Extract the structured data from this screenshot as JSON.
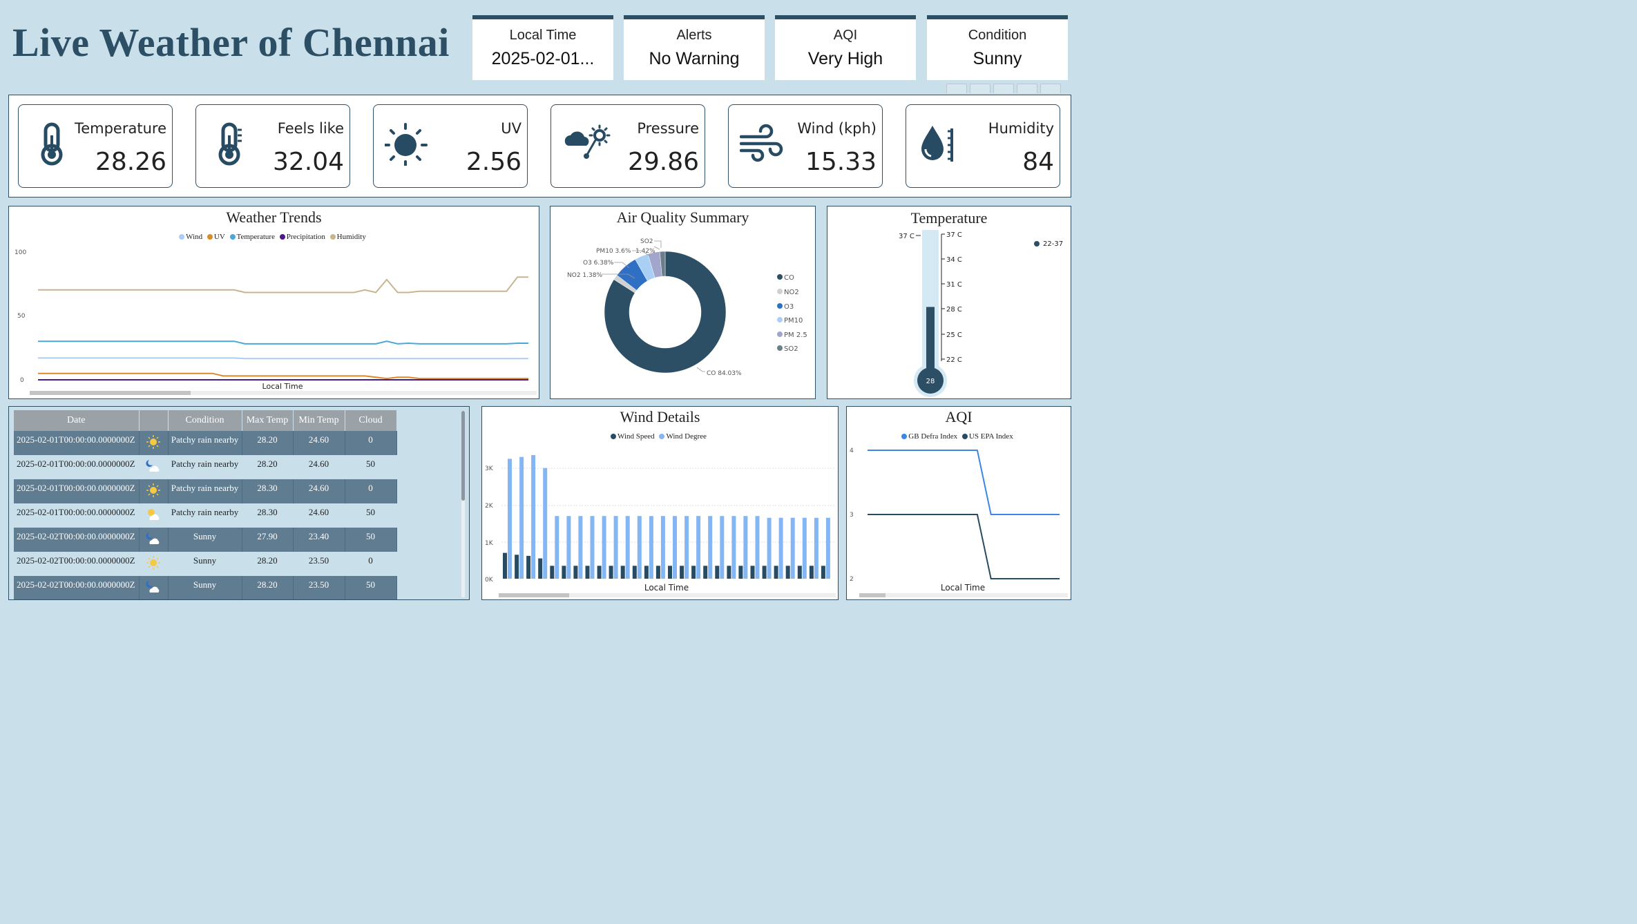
{
  "title": "Live Weather of Chennai",
  "header_cards": [
    {
      "label": "Local Time",
      "value": "2025-02-01..."
    },
    {
      "label": "Alerts",
      "value": "No Warning"
    },
    {
      "label": "AQI",
      "value": "Very High"
    },
    {
      "label": "Condition",
      "value": "Sunny"
    }
  ],
  "kpis": [
    {
      "label": "Temperature",
      "value": "28.26",
      "icon": "thermometer-icon"
    },
    {
      "label": "Feels like",
      "value": "32.04",
      "icon": "thermometer-feels-icon"
    },
    {
      "label": "UV",
      "value": "2.56",
      "icon": "sun-icon"
    },
    {
      "label": "Pressure",
      "value": "29.86",
      "icon": "cloud-gauge-icon"
    },
    {
      "label": "Wind (kph)",
      "value": "15.33",
      "icon": "wind-icon"
    },
    {
      "label": "Humidity",
      "value": "84",
      "icon": "humidity-drop-icon"
    }
  ],
  "colors": {
    "dark": "#2c4f66",
    "navy": "#264b62",
    "blue": "#2f6fc4",
    "light_blue": "#84b6f4",
    "trend_wind": "#aacdf6",
    "trend_uv": "#d98b2b",
    "trend_temp": "#4aa8d8",
    "trend_precip": "#4b1a8a",
    "trend_humidity": "#c8b48f"
  },
  "weather_trends": {
    "title": "Weather Trends",
    "legend": [
      "Wind",
      "UV",
      "Temperature",
      "Precipitation",
      "Humidity"
    ],
    "y_ticks": [
      "100",
      "50",
      "0"
    ],
    "x_label": "Local Time",
    "chart_data": {
      "type": "line",
      "ylim": [
        0,
        100
      ],
      "series": [
        {
          "name": "Humidity",
          "values": [
            70,
            70,
            70,
            70,
            70,
            70,
            70,
            70,
            70,
            70,
            70,
            70,
            70,
            70,
            70,
            70,
            70,
            70,
            70,
            68,
            68,
            68,
            68,
            68,
            68,
            68,
            68,
            68,
            68,
            68,
            70,
            68,
            78,
            68,
            68,
            69,
            69,
            69,
            69,
            69,
            69,
            69,
            69,
            69,
            80,
            80
          ]
        },
        {
          "name": "Temperature",
          "values": [
            30,
            30,
            30,
            30,
            30,
            30,
            30,
            30,
            30,
            30,
            30,
            30,
            30,
            30,
            30,
            30,
            30,
            30,
            30,
            28,
            28,
            28,
            28,
            28,
            28,
            28,
            28,
            28,
            28,
            28,
            28,
            28,
            30,
            28,
            28.5,
            28,
            28,
            28,
            28,
            28,
            28,
            28,
            28,
            28,
            28.5,
            28.5
          ]
        },
        {
          "name": "Wind",
          "values": [
            17,
            17,
            17,
            17,
            17,
            17,
            17,
            17,
            17,
            17,
            17,
            17,
            17,
            17,
            17,
            17,
            17,
            17,
            17,
            16.5,
            16.5,
            16.5,
            16.5,
            16.5,
            16.5,
            16.5,
            16.5,
            16.5,
            16.5,
            16.5,
            16.5,
            16.5,
            16.5,
            16.5,
            16.5,
            16.5,
            16.5,
            16.5,
            16.5,
            16.5,
            16.5,
            16.5,
            16.5,
            16.5,
            16.5,
            16.5
          ]
        },
        {
          "name": "UV",
          "values": [
            5,
            5,
            5,
            5,
            5,
            5,
            5,
            5,
            5,
            5,
            5,
            5,
            5,
            5,
            5,
            5,
            5,
            3,
            3,
            3,
            3,
            3,
            3,
            3,
            3,
            3,
            3,
            3,
            3,
            3,
            3,
            2,
            1,
            2,
            2,
            1,
            1,
            1,
            1,
            1,
            1,
            1,
            1,
            1,
            1,
            1
          ]
        },
        {
          "name": "Precipitation",
          "values": [
            0,
            0,
            0,
            0,
            0,
            0,
            0,
            0,
            0,
            0,
            0,
            0,
            0,
            0,
            0,
            0,
            0,
            0,
            0,
            0,
            0,
            0,
            0,
            0,
            0,
            0,
            0,
            0,
            0,
            0,
            0,
            0,
            0,
            0,
            0,
            0,
            0,
            0,
            0,
            0,
            0,
            0,
            0,
            0,
            0,
            0
          ]
        }
      ]
    }
  },
  "air_quality": {
    "title": "Air Quality Summary",
    "legend": [
      "CO",
      "NO2",
      "O3",
      "PM10",
      "PM 2.5",
      "SO2"
    ],
    "labels": {
      "co": "CO 84.03%",
      "no2": "NO2 1.38%",
      "o3": "O3 6.38%",
      "pm10": "PM10 3.6%",
      "pm25": "1.42%",
      "so2": "SO2"
    },
    "chart_data": {
      "type": "pie",
      "categories": [
        "CO",
        "NO2",
        "O3",
        "PM10",
        "PM 2.5",
        "SO2"
      ],
      "values": [
        84.03,
        1.38,
        6.38,
        3.6,
        3.19,
        1.42
      ]
    }
  },
  "temperature_gauge": {
    "title": "Temperature",
    "max_label": "37 C",
    "ticks": [
      "37 C",
      "34 C",
      "31 C",
      "28 C",
      "25 C",
      "22 C"
    ],
    "bulb_value": "28",
    "legend": "22-37",
    "chart_data": {
      "type": "bar",
      "value": 28.26,
      "ylim": [
        22,
        37
      ]
    }
  },
  "forecast_table": {
    "columns": [
      "Date",
      "",
      "Condition",
      "Max Temp",
      "Min Temp",
      "Cloud"
    ],
    "rows": [
      {
        "date": "2025-02-01T00:00:00.0000000Z",
        "icon": "sun-icon",
        "condition": "Patchy rain nearby",
        "max": "28.20",
        "min": "24.60",
        "cloud": "0"
      },
      {
        "date": "2025-02-01T00:00:00.0000000Z",
        "icon": "moon-cloud-icon",
        "condition": "Patchy rain nearby",
        "max": "28.20",
        "min": "24.60",
        "cloud": "50"
      },
      {
        "date": "2025-02-01T00:00:00.0000000Z",
        "icon": "sun-icon",
        "condition": "Patchy rain nearby",
        "max": "28.30",
        "min": "24.60",
        "cloud": "0"
      },
      {
        "date": "2025-02-01T00:00:00.0000000Z",
        "icon": "sun-cloud-icon",
        "condition": "Patchy rain nearby",
        "max": "28.30",
        "min": "24.60",
        "cloud": "50"
      },
      {
        "date": "2025-02-02T00:00:00.0000000Z",
        "icon": "moon-cloud-icon",
        "condition": "Sunny",
        "max": "27.90",
        "min": "23.40",
        "cloud": "50"
      },
      {
        "date": "2025-02-02T00:00:00.0000000Z",
        "icon": "sun-icon",
        "condition": "Sunny",
        "max": "28.20",
        "min": "23.50",
        "cloud": "0"
      },
      {
        "date": "2025-02-02T00:00:00.0000000Z",
        "icon": "moon-cloud-icon",
        "condition": "Sunny",
        "max": "28.20",
        "min": "23.50",
        "cloud": "50"
      }
    ]
  },
  "wind_details": {
    "title": "Wind Details",
    "legend": [
      "Wind Speed",
      "Wind Degree"
    ],
    "y_ticks": [
      "3K",
      "2K",
      "1K",
      "0K"
    ],
    "x_label": "Local Time",
    "chart_data": {
      "type": "bar",
      "ylim": [
        0,
        3500
      ],
      "series": [
        {
          "name": "Wind Speed",
          "values": [
            700,
            650,
            620,
            550,
            350,
            350,
            350,
            350,
            350,
            350,
            350,
            350,
            350,
            350,
            350,
            350,
            350,
            350,
            350,
            350,
            350,
            350,
            350,
            350,
            350,
            350,
            350,
            350
          ]
        },
        {
          "name": "Wind Degree",
          "values": [
            3250,
            3300,
            3350,
            3000,
            1700,
            1700,
            1700,
            1700,
            1700,
            1700,
            1700,
            1700,
            1700,
            1700,
            1700,
            1700,
            1700,
            1700,
            1700,
            1700,
            1700,
            1700,
            1650,
            1650,
            1650,
            1650,
            1650,
            1650
          ]
        }
      ]
    }
  },
  "aqi_chart": {
    "title": "AQI",
    "legend": [
      "GB Defra Index",
      "US EPA Index"
    ],
    "y_ticks": [
      "4",
      "3",
      "2"
    ],
    "x_label": "Local Time",
    "chart_data": {
      "type": "line",
      "ylim": [
        2,
        4
      ],
      "series": [
        {
          "name": "GB Defra Index",
          "values": [
            4,
            4,
            4,
            4,
            4,
            4,
            4,
            4,
            4,
            3,
            3,
            3,
            3,
            3,
            3
          ]
        },
        {
          "name": "US EPA Index",
          "values": [
            3,
            3,
            3,
            3,
            3,
            3,
            3,
            3,
            3,
            2,
            2,
            2,
            2,
            2,
            2
          ]
        }
      ]
    }
  }
}
